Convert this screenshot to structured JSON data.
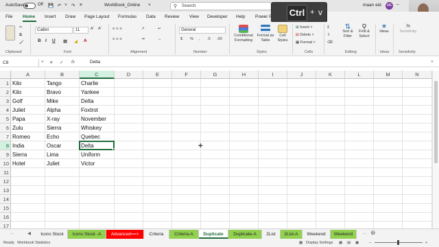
{
  "titlebar": {
    "autosave": "AutoSave",
    "toggle_state": "Off",
    "filename": "WorkBook_Online",
    "search_placeholder": "Search",
    "user_name": "maan eid",
    "user_initials": "ME"
  },
  "keystroke_overlay": {
    "key1": "Ctrl",
    "plus": "+",
    "key2": "v"
  },
  "menu": {
    "tabs": [
      "File",
      "Home",
      "Insert",
      "Draw",
      "Page Layout",
      "Formulas",
      "Data",
      "Review",
      "View",
      "Developer",
      "Help",
      "Power Pivot"
    ],
    "active": "Home"
  },
  "ribbon": {
    "groups": {
      "clipboard": "Clipboard",
      "font": "Font",
      "alignment": "Alignment",
      "number": "Number",
      "styles": "Styles",
      "cells": "Cells",
      "editing": "Editing",
      "ideas": "Ideas",
      "sensitivity": "Sensitivity"
    },
    "font_name": "Calibri",
    "font_size": "11",
    "number_format": "General",
    "buttons": {
      "conditional_formatting": "Conditional Formatting",
      "format_as_table": "Format as Table",
      "cell_styles": "Cell Styles",
      "insert": "Insert",
      "delete": "Delete",
      "format": "Format",
      "sort_filter": "Sort & Filter",
      "find_select": "Find & Select",
      "ideas": "Ideas",
      "sensitivity": "Sensitivity"
    }
  },
  "formula_bar": {
    "name_box": "C8",
    "fx": "fx",
    "value": "Delta"
  },
  "grid": {
    "columns": [
      "A",
      "B",
      "C",
      "D",
      "E",
      "F",
      "G",
      "H",
      "I",
      "J",
      "K",
      "L",
      "M",
      "N"
    ],
    "selected_column": "C",
    "selected_row": "8",
    "rows": [
      {
        "num": "1",
        "a": "Kilo",
        "b": "Tango",
        "c": "Charlie"
      },
      {
        "num": "2",
        "a": "Kilo",
        "b": "Bravo",
        "c": "Yankee"
      },
      {
        "num": "3",
        "a": "Golf",
        "b": "Mike",
        "c": "Delta"
      },
      {
        "num": "4",
        "a": "Juliet",
        "b": "Alpha",
        "c": "Foxtrot"
      },
      {
        "num": "5",
        "a": "Papa",
        "b": "X-ray",
        "c": "November"
      },
      {
        "num": "6",
        "a": "Zulu",
        "b": "Sierra",
        "c": "Whiskey"
      },
      {
        "num": "7",
        "a": "Romeo",
        "b": "Echo",
        "c": "Quebec"
      },
      {
        "num": "8",
        "a": "India",
        "b": "Oscar",
        "c": "Delta"
      },
      {
        "num": "9",
        "a": "Sierra",
        "b": "Lima",
        "c": "Uniform"
      },
      {
        "num": "10",
        "a": "Hotel",
        "b": "Juliet",
        "c": "Victor"
      },
      {
        "num": "11",
        "a": "",
        "b": "",
        "c": ""
      },
      {
        "num": "12",
        "a": "",
        "b": "",
        "c": ""
      },
      {
        "num": "13",
        "a": "",
        "b": "",
        "c": ""
      },
      {
        "num": "14",
        "a": "",
        "b": "",
        "c": ""
      },
      {
        "num": "15",
        "a": "",
        "b": "",
        "c": ""
      },
      {
        "num": "16",
        "a": "",
        "b": "",
        "c": ""
      },
      {
        "num": "17",
        "a": "",
        "b": "",
        "c": ""
      }
    ]
  },
  "sheet_tabs": [
    {
      "label": "Icons Stock",
      "color": "#f3f3f3"
    },
    {
      "label": "Icons Stock -A",
      "color": "#92d050"
    },
    {
      "label": "Advanced==>",
      "color": "#ff0000"
    },
    {
      "label": "Criteria",
      "color": "#f3f3f3"
    },
    {
      "label": "Criteria-A",
      "color": "#92d050"
    },
    {
      "label": "Duplicate",
      "color": "#ffffff"
    },
    {
      "label": "Duplicate-A",
      "color": "#92d050"
    },
    {
      "label": "2List",
      "color": "#f3f3f3"
    },
    {
      "label": "2List-A",
      "color": "#92d050"
    },
    {
      "label": "Weekend",
      "color": "#f3f3f3"
    },
    {
      "label": "Weekend",
      "color": "#92d050"
    }
  ],
  "status": {
    "ready": "Ready",
    "stats": "Workbook Statistics",
    "display_settings": "Display Settings"
  },
  "colors": {
    "accent": "#1e6b3a",
    "tab_green": "#92d050",
    "tab_red": "#ff0000"
  }
}
